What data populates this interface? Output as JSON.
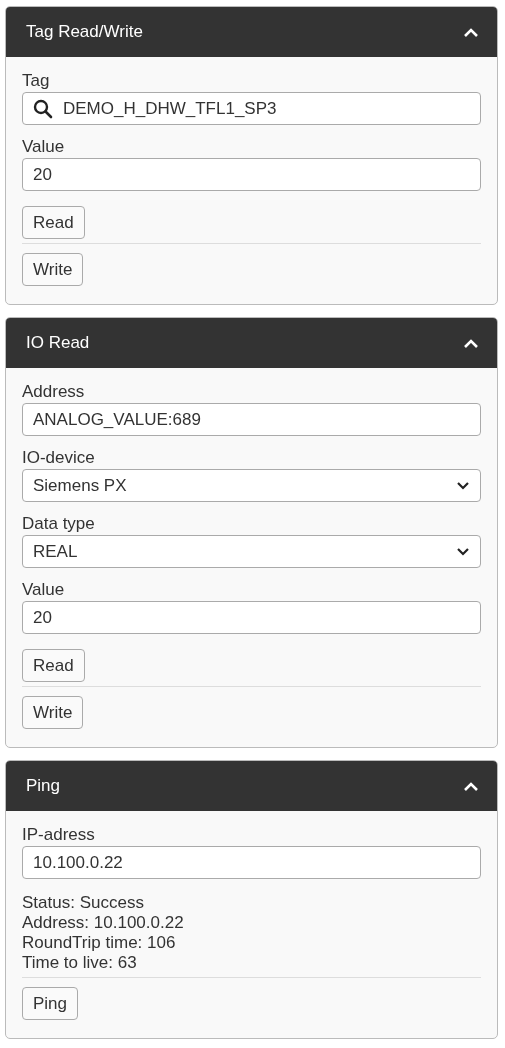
{
  "panels": [
    {
      "title": "Tag Read/Write",
      "expanded": true,
      "items": [
        {
          "kind": "search_field",
          "label": "Tag",
          "value": "DEMO_H_DHW_TFL1_SP3"
        },
        {
          "kind": "field",
          "label": "Value",
          "value": "20"
        },
        {
          "kind": "button",
          "label": "Read"
        },
        {
          "kind": "rule"
        },
        {
          "kind": "button",
          "label": "Write"
        }
      ]
    },
    {
      "title": "IO Read",
      "expanded": true,
      "items": [
        {
          "kind": "field",
          "label": "Address",
          "value": "ANALOG_VALUE:689"
        },
        {
          "kind": "select",
          "label": "IO-device",
          "value": "Siemens PX"
        },
        {
          "kind": "select",
          "label": "Data type",
          "value": "REAL"
        },
        {
          "kind": "field",
          "label": "Value",
          "value": "20"
        },
        {
          "kind": "button",
          "label": "Read"
        },
        {
          "kind": "rule"
        },
        {
          "kind": "button",
          "label": "Write"
        }
      ]
    },
    {
      "title": "Ping",
      "expanded": true,
      "items": [
        {
          "kind": "field",
          "label": "IP-adress",
          "value": "10.100.0.22"
        },
        {
          "kind": "info",
          "lines": [
            "Status: Success",
            "Address: 10.100.0.22",
            "RoundTrip time: 106",
            "Time to live: 63"
          ]
        },
        {
          "kind": "rule"
        },
        {
          "kind": "button",
          "label": "Ping"
        }
      ]
    }
  ]
}
